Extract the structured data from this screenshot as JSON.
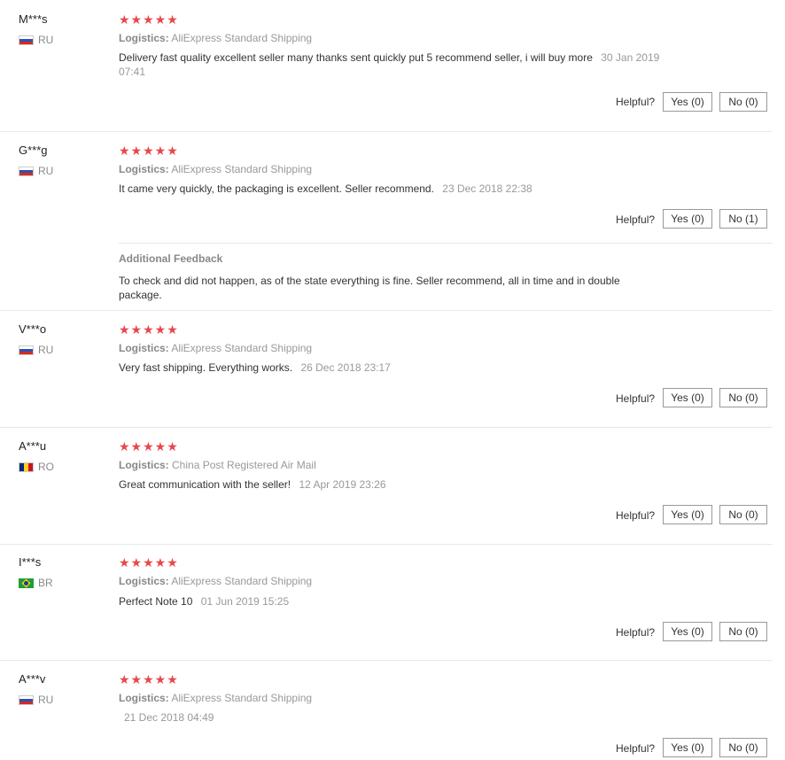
{
  "helpful_label": "Helpful?",
  "colors": {
    "star": "#e8474c",
    "separator": "#e8e8e8",
    "muted": "#999999"
  },
  "reviews": [
    {
      "user": "M***s",
      "country": "RU",
      "flag": "flag-ru",
      "rating": 5,
      "stars": "★★★★★",
      "logistics_label": "Logistics:",
      "logistics": "AliExpress Standard Shipping",
      "text": "Delivery fast quality excellent seller many thanks sent quickly put 5 recommend seller, i will buy more",
      "date": "30 Jan 2019 07:41",
      "yes": "Yes (0)",
      "no": "No (0)"
    },
    {
      "user": "G***g",
      "country": "RU",
      "flag": "flag-ru",
      "rating": 5,
      "stars": "★★★★★",
      "logistics_label": "Logistics:",
      "logistics": "AliExpress Standard Shipping",
      "text": "It came very quickly, the packaging is excellent. Seller recommend.",
      "date": "23 Dec 2018 22:38",
      "yes": "Yes (0)",
      "no": "No (1)",
      "additional_title": "Additional Feedback",
      "additional_text": "To check and did not happen, as of the state everything is fine. Seller recommend, all in time and in double package."
    },
    {
      "user": "V***o",
      "country": "RU",
      "flag": "flag-ru",
      "rating": 5,
      "stars": "★★★★★",
      "logistics_label": "Logistics:",
      "logistics": "AliExpress Standard Shipping",
      "text": "Very fast shipping. Everything works.",
      "date": "26 Dec 2018 23:17",
      "yes": "Yes (0)",
      "no": "No (0)"
    },
    {
      "user": "A***u",
      "country": "RO",
      "flag": "flag-ro",
      "rating": 5,
      "stars": "★★★★★",
      "logistics_label": "Logistics:",
      "logistics": "China Post Registered Air Mail",
      "text": "Great communication with the seller!",
      "date": "12 Apr 2019 23:26",
      "yes": "Yes (0)",
      "no": "No (0)"
    },
    {
      "user": "I***s",
      "country": "BR",
      "flag": "flag-br",
      "rating": 5,
      "stars": "★★★★★",
      "logistics_label": "Logistics:",
      "logistics": "AliExpress Standard Shipping",
      "text": "Perfect Note 10",
      "date": "01 Jun 2019 15:25",
      "yes": "Yes (0)",
      "no": "No (0)"
    },
    {
      "user": "A***v",
      "country": "RU",
      "flag": "flag-ru",
      "rating": 5,
      "stars": "★★★★★",
      "logistics_label": "Logistics:",
      "logistics": "AliExpress Standard Shipping",
      "text": "",
      "date": "21 Dec 2018 04:49",
      "yes": "Yes (0)",
      "no": "No (0)"
    }
  ]
}
